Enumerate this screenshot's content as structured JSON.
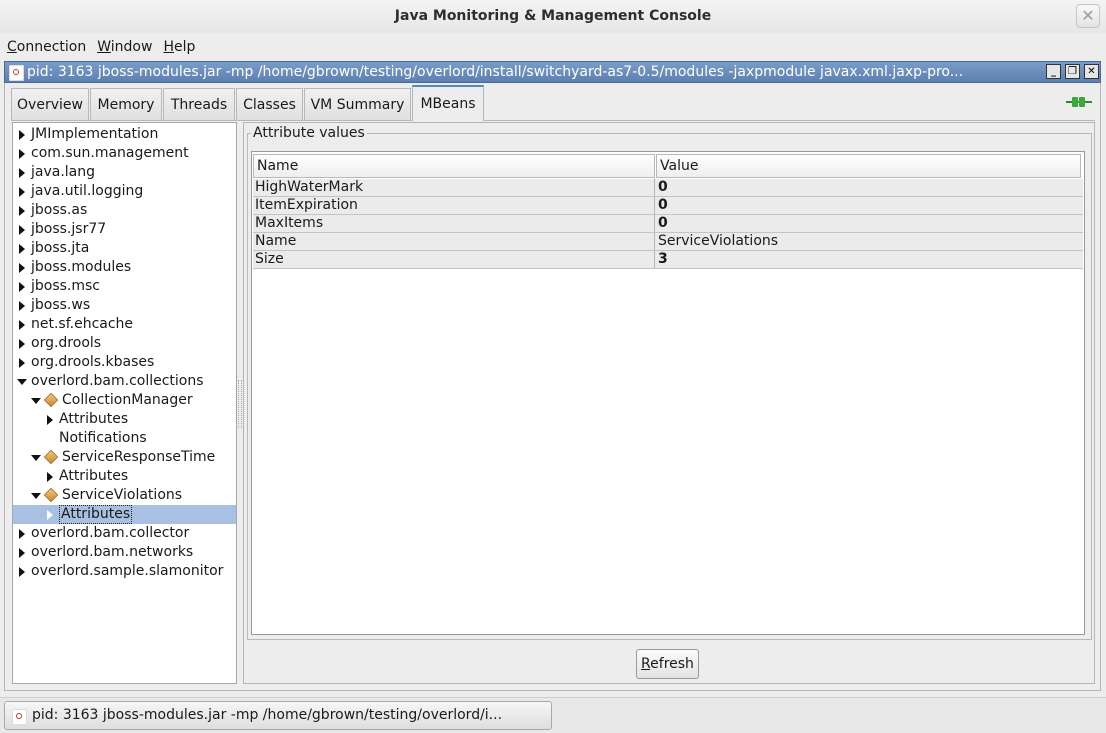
{
  "window": {
    "title": "Java Monitoring & Management Console",
    "close_glyph": "✕"
  },
  "menu": [
    {
      "accel": "C",
      "rest": "onnection"
    },
    {
      "accel": "W",
      "rest": "indow"
    },
    {
      "accel": "H",
      "rest": "elp"
    }
  ],
  "internal_frame": {
    "title": "pid: 3163 jboss-modules.jar -mp /home/gbrown/testing/overlord/install/switchyard-as7-0.5/modules -jaxpmodule javax.xml.jaxp-pro...",
    "buttons": {
      "minimize": "_",
      "restore": "❐",
      "close": "✕"
    }
  },
  "tabs": [
    "Overview",
    "Memory",
    "Threads",
    "Classes",
    "VM Summary",
    "MBeans"
  ],
  "active_tab": "MBeans",
  "tree": {
    "nodes": [
      {
        "label": "JMImplementation",
        "level": 0,
        "state": "collapsed"
      },
      {
        "label": "com.sun.management",
        "level": 0,
        "state": "collapsed"
      },
      {
        "label": "java.lang",
        "level": 0,
        "state": "collapsed"
      },
      {
        "label": "java.util.logging",
        "level": 0,
        "state": "collapsed"
      },
      {
        "label": "jboss.as",
        "level": 0,
        "state": "collapsed"
      },
      {
        "label": "jboss.jsr77",
        "level": 0,
        "state": "collapsed"
      },
      {
        "label": "jboss.jta",
        "level": 0,
        "state": "collapsed"
      },
      {
        "label": "jboss.modules",
        "level": 0,
        "state": "collapsed"
      },
      {
        "label": "jboss.msc",
        "level": 0,
        "state": "collapsed"
      },
      {
        "label": "jboss.ws",
        "level": 0,
        "state": "collapsed"
      },
      {
        "label": "net.sf.ehcache",
        "level": 0,
        "state": "collapsed"
      },
      {
        "label": "org.drools",
        "level": 0,
        "state": "collapsed"
      },
      {
        "label": "org.drools.kbases",
        "level": 0,
        "state": "collapsed"
      },
      {
        "label": "overlord.bam.collections",
        "level": 0,
        "state": "expanded"
      },
      {
        "label": "CollectionManager",
        "level": 1,
        "state": "expanded",
        "bean": true
      },
      {
        "label": "Attributes",
        "level": 2,
        "state": "collapsed"
      },
      {
        "label": "Notifications",
        "level": 2,
        "state": "leaf"
      },
      {
        "label": "ServiceResponseTime",
        "level": 1,
        "state": "expanded",
        "bean": true
      },
      {
        "label": "Attributes",
        "level": 2,
        "state": "collapsed"
      },
      {
        "label": "ServiceViolations",
        "level": 1,
        "state": "expanded",
        "bean": true
      },
      {
        "label": "Attributes",
        "level": 2,
        "state": "collapsed",
        "selected": true
      },
      {
        "label": "overlord.bam.collector",
        "level": 0,
        "state": "collapsed"
      },
      {
        "label": "overlord.bam.networks",
        "level": 0,
        "state": "collapsed"
      },
      {
        "label": "overlord.sample.slamonitor",
        "level": 0,
        "state": "collapsed"
      }
    ]
  },
  "attributes": {
    "legend": "Attribute values",
    "columns": [
      "Name",
      "Value"
    ],
    "rows": [
      {
        "name": "HighWaterMark",
        "value": "0",
        "bold": true
      },
      {
        "name": "ItemExpiration",
        "value": "0",
        "bold": true
      },
      {
        "name": "MaxItems",
        "value": "0",
        "bold": true
      },
      {
        "name": "Name",
        "value": "ServiceViolations",
        "bold": false
      },
      {
        "name": "Size",
        "value": "3",
        "bold": true
      }
    ]
  },
  "refresh": {
    "accel": "R",
    "rest": "efresh"
  },
  "statusbar": {
    "task_label": "pid: 3163 jboss-modules.jar -mp /home/gbrown/testing/overlord/i..."
  },
  "colors": {
    "selection": "#a8c1e3",
    "frame_title": "#6a8fc0",
    "connected": "#3ba83b"
  }
}
